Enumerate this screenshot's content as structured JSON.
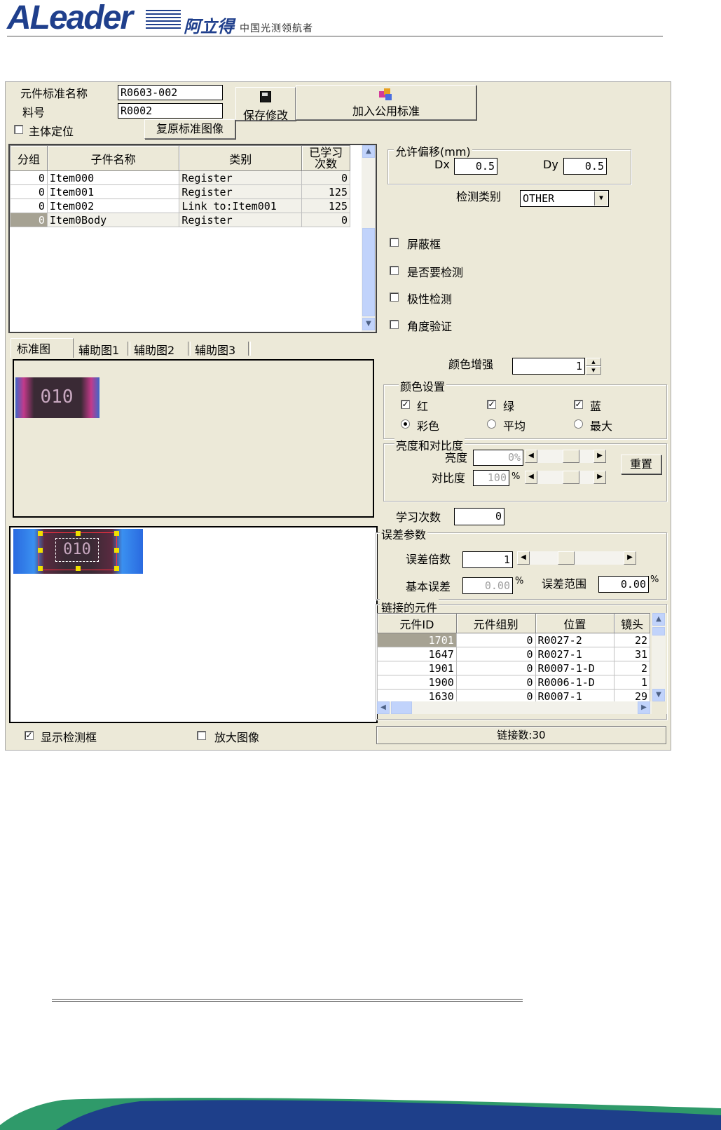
{
  "header": {
    "logo_text": "ALeader",
    "logo_cn": "阿立得",
    "tagline": "中国光测领航者"
  },
  "form": {
    "std_name_label": "元件标准名称",
    "std_name_value": "R0603-002",
    "part_no_label": "料号",
    "part_no_value": "R0002",
    "save_button": "保存修改",
    "add_public_button": "加入公用标准",
    "main_locate_label": "主体定位",
    "restore_image_button": "复原标准图像"
  },
  "items_table": {
    "headers": [
      "分组",
      "子件名称",
      "类别",
      "已学习",
      "次数"
    ],
    "rows": [
      {
        "group": "0",
        "name": "Item000",
        "type": "Register",
        "count": "0"
      },
      {
        "group": "0",
        "name": "Item001",
        "type": "Register",
        "count": "125"
      },
      {
        "group": "0",
        "name": "Item002",
        "type": "Link to:Item001",
        "count": "125"
      },
      {
        "group": "0",
        "name": "Item0Body",
        "type": "Register",
        "count": "0"
      }
    ]
  },
  "tabs": [
    "标准图",
    "辅助图1",
    "辅助图2",
    "辅助图3"
  ],
  "bottom_checks": {
    "show_box_label": "显示检测框",
    "show_box_mark": "✓",
    "enlarge_label": "放大图像"
  },
  "offset": {
    "title": "允许偏移(mm)",
    "dx_label": "Dx",
    "dx_value": "0.5",
    "dy_label": "Dy",
    "dy_value": "0.5",
    "detect_type_label": "检测类别",
    "detect_type_value": "OTHER"
  },
  "options": [
    "屏蔽框",
    "是否要检测",
    "极性检测",
    "角度验证"
  ],
  "color_enhance": {
    "label": "颜色增强",
    "value": "1"
  },
  "color_settings": {
    "title": "颜色设置",
    "checks": [
      {
        "label": "红",
        "mark": "✓"
      },
      {
        "label": "绿",
        "mark": "✓"
      },
      {
        "label": "蓝",
        "mark": "✓"
      }
    ],
    "radios": [
      {
        "label": "彩色",
        "selected": true
      },
      {
        "label": "平均",
        "selected": false
      },
      {
        "label": "最大",
        "selected": false
      }
    ]
  },
  "brightness": {
    "title": "亮度和对比度",
    "brightness_label": "亮度",
    "brightness_value": "0%",
    "contrast_label": "对比度",
    "contrast_value": "100",
    "contrast_unit": "%",
    "reset_button": "重置"
  },
  "learn_count": {
    "label": "学习次数",
    "value": "0"
  },
  "error_params": {
    "title": "误差参数",
    "multiplier_label": "误差倍数",
    "multiplier_value": "1",
    "base_label": "基本误差",
    "base_value": "0.00",
    "base_unit": "%",
    "range_label": "误差范围",
    "range_value": "0.00",
    "range_unit": "%"
  },
  "linked": {
    "title": "链接的元件",
    "headers": [
      "元件ID",
      "元件组别",
      "位置",
      "镜头"
    ],
    "rows": [
      {
        "id": "1701",
        "group": "0",
        "pos": "R0027-2",
        "lens": "22"
      },
      {
        "id": "1647",
        "group": "0",
        "pos": "R0027-1",
        "lens": "31"
      },
      {
        "id": "1901",
        "group": "0",
        "pos": "R0007-1-D",
        "lens": "2"
      },
      {
        "id": "1900",
        "group": "0",
        "pos": "R0006-1-D",
        "lens": "1"
      },
      {
        "id": "1630",
        "group": "0",
        "pos": "R0007-1",
        "lens": "29"
      }
    ],
    "count_label": "链接数:30"
  },
  "chip_text": "010",
  "colors": {
    "brand": "#1f3f8c",
    "window_bg": "#ece9d8",
    "selected": "#a6a293"
  }
}
